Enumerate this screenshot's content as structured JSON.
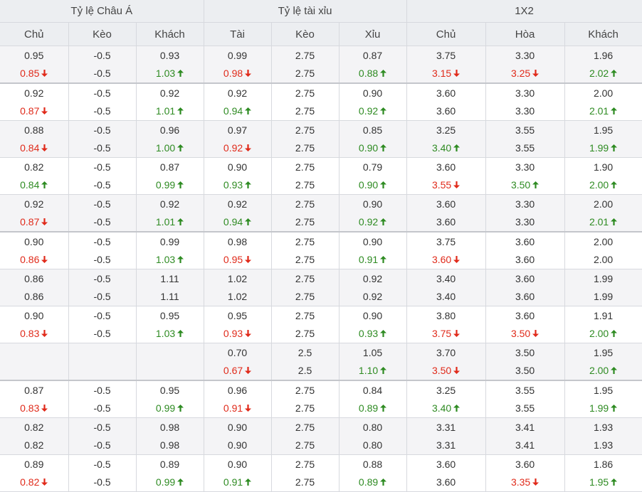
{
  "headers": {
    "groups": [
      "Tỷ lệ Châu Á",
      "Tỷ lệ tài xỉu",
      "1X2"
    ],
    "columns": [
      "Chủ",
      "Kèo",
      "Khách",
      "Tài",
      "Kèo",
      "Xỉu",
      "Chủ",
      "Hòa",
      "Khách"
    ]
  },
  "colors": {
    "up": "#2e8b22",
    "down": "#e02a1a",
    "header_bg": "#eceef1",
    "stripe_bg": "#f4f4f6"
  },
  "rows": [
    {
      "cells": [
        {
          "open": "0.95",
          "cur": "0.85",
          "trend": "down"
        },
        {
          "open": "-0.5",
          "cur": "-0.5",
          "trend": ""
        },
        {
          "open": "0.93",
          "cur": "1.03",
          "trend": "up"
        },
        {
          "open": "0.99",
          "cur": "0.98",
          "trend": "down"
        },
        {
          "open": "2.75",
          "cur": "2.75",
          "trend": ""
        },
        {
          "open": "0.87",
          "cur": "0.88",
          "trend": "up"
        },
        {
          "open": "3.75",
          "cur": "3.15",
          "trend": "down"
        },
        {
          "open": "3.30",
          "cur": "3.25",
          "trend": "down"
        },
        {
          "open": "1.96",
          "cur": "2.02",
          "trend": "up"
        }
      ]
    },
    {
      "cells": [
        {
          "open": "0.92",
          "cur": "0.87",
          "trend": "down"
        },
        {
          "open": "-0.5",
          "cur": "-0.5",
          "trend": ""
        },
        {
          "open": "0.92",
          "cur": "1.01",
          "trend": "up"
        },
        {
          "open": "0.92",
          "cur": "0.94",
          "trend": "up"
        },
        {
          "open": "2.75",
          "cur": "2.75",
          "trend": ""
        },
        {
          "open": "0.90",
          "cur": "0.92",
          "trend": "up"
        },
        {
          "open": "3.60",
          "cur": "3.60",
          "trend": ""
        },
        {
          "open": "3.30",
          "cur": "3.30",
          "trend": ""
        },
        {
          "open": "2.00",
          "cur": "2.01",
          "trend": "up"
        }
      ]
    },
    {
      "cells": [
        {
          "open": "0.88",
          "cur": "0.84",
          "trend": "down"
        },
        {
          "open": "-0.5",
          "cur": "-0.5",
          "trend": ""
        },
        {
          "open": "0.96",
          "cur": "1.00",
          "trend": "up"
        },
        {
          "open": "0.97",
          "cur": "0.92",
          "trend": "down"
        },
        {
          "open": "2.75",
          "cur": "2.75",
          "trend": ""
        },
        {
          "open": "0.85",
          "cur": "0.90",
          "trend": "up"
        },
        {
          "open": "3.25",
          "cur": "3.40",
          "trend": "up"
        },
        {
          "open": "3.55",
          "cur": "3.55",
          "trend": ""
        },
        {
          "open": "1.95",
          "cur": "1.99",
          "trend": "up"
        }
      ]
    },
    {
      "cells": [
        {
          "open": "0.82",
          "cur": "0.84",
          "trend": "up"
        },
        {
          "open": "-0.5",
          "cur": "-0.5",
          "trend": ""
        },
        {
          "open": "0.87",
          "cur": "0.99",
          "trend": "up"
        },
        {
          "open": "0.90",
          "cur": "0.93",
          "trend": "up"
        },
        {
          "open": "2.75",
          "cur": "2.75",
          "trend": ""
        },
        {
          "open": "0.79",
          "cur": "0.90",
          "trend": "up"
        },
        {
          "open": "3.60",
          "cur": "3.55",
          "trend": "down"
        },
        {
          "open": "3.30",
          "cur": "3.50",
          "trend": "up"
        },
        {
          "open": "1.90",
          "cur": "2.00",
          "trend": "up"
        }
      ]
    },
    {
      "cells": [
        {
          "open": "0.92",
          "cur": "0.87",
          "trend": "down"
        },
        {
          "open": "-0.5",
          "cur": "-0.5",
          "trend": ""
        },
        {
          "open": "0.92",
          "cur": "1.01",
          "trend": "up"
        },
        {
          "open": "0.92",
          "cur": "0.94",
          "trend": "up"
        },
        {
          "open": "2.75",
          "cur": "2.75",
          "trend": ""
        },
        {
          "open": "0.90",
          "cur": "0.92",
          "trend": "up"
        },
        {
          "open": "3.60",
          "cur": "3.60",
          "trend": ""
        },
        {
          "open": "3.30",
          "cur": "3.30",
          "trend": ""
        },
        {
          "open": "2.00",
          "cur": "2.01",
          "trend": "up"
        }
      ]
    },
    {
      "cells": [
        {
          "open": "0.90",
          "cur": "0.86",
          "trend": "down"
        },
        {
          "open": "-0.5",
          "cur": "-0.5",
          "trend": ""
        },
        {
          "open": "0.99",
          "cur": "1.03",
          "trend": "up"
        },
        {
          "open": "0.98",
          "cur": "0.95",
          "trend": "down"
        },
        {
          "open": "2.75",
          "cur": "2.75",
          "trend": ""
        },
        {
          "open": "0.90",
          "cur": "0.91",
          "trend": "up"
        },
        {
          "open": "3.75",
          "cur": "3.60",
          "trend": "down"
        },
        {
          "open": "3.60",
          "cur": "3.60",
          "trend": ""
        },
        {
          "open": "2.00",
          "cur": "2.00",
          "trend": ""
        }
      ]
    },
    {
      "cells": [
        {
          "open": "0.86",
          "cur": "0.86",
          "trend": ""
        },
        {
          "open": "-0.5",
          "cur": "-0.5",
          "trend": ""
        },
        {
          "open": "1.11",
          "cur": "1.11",
          "trend": ""
        },
        {
          "open": "1.02",
          "cur": "1.02",
          "trend": ""
        },
        {
          "open": "2.75",
          "cur": "2.75",
          "trend": ""
        },
        {
          "open": "0.92",
          "cur": "0.92",
          "trend": ""
        },
        {
          "open": "3.40",
          "cur": "3.40",
          "trend": ""
        },
        {
          "open": "3.60",
          "cur": "3.60",
          "trend": ""
        },
        {
          "open": "1.99",
          "cur": "1.99",
          "trend": ""
        }
      ]
    },
    {
      "cells": [
        {
          "open": "0.90",
          "cur": "0.83",
          "trend": "down"
        },
        {
          "open": "-0.5",
          "cur": "-0.5",
          "trend": ""
        },
        {
          "open": "0.95",
          "cur": "1.03",
          "trend": "up"
        },
        {
          "open": "0.95",
          "cur": "0.93",
          "trend": "down"
        },
        {
          "open": "2.75",
          "cur": "2.75",
          "trend": ""
        },
        {
          "open": "0.90",
          "cur": "0.93",
          "trend": "up"
        },
        {
          "open": "3.80",
          "cur": "3.75",
          "trend": "down"
        },
        {
          "open": "3.60",
          "cur": "3.50",
          "trend": "down"
        },
        {
          "open": "1.91",
          "cur": "2.00",
          "trend": "up"
        }
      ]
    },
    {
      "cells": [
        {
          "open": "",
          "cur": "",
          "trend": ""
        },
        {
          "open": "",
          "cur": "",
          "trend": ""
        },
        {
          "open": "",
          "cur": "",
          "trend": ""
        },
        {
          "open": "0.70",
          "cur": "0.67",
          "trend": "down"
        },
        {
          "open": "2.5",
          "cur": "2.5",
          "trend": ""
        },
        {
          "open": "1.05",
          "cur": "1.10",
          "trend": "up"
        },
        {
          "open": "3.70",
          "cur": "3.50",
          "trend": "down"
        },
        {
          "open": "3.50",
          "cur": "3.50",
          "trend": ""
        },
        {
          "open": "1.95",
          "cur": "2.00",
          "trend": "up"
        }
      ]
    },
    {
      "cells": [
        {
          "open": "0.87",
          "cur": "0.83",
          "trend": "down"
        },
        {
          "open": "-0.5",
          "cur": "-0.5",
          "trend": ""
        },
        {
          "open": "0.95",
          "cur": "0.99",
          "trend": "up"
        },
        {
          "open": "0.96",
          "cur": "0.91",
          "trend": "down"
        },
        {
          "open": "2.75",
          "cur": "2.75",
          "trend": ""
        },
        {
          "open": "0.84",
          "cur": "0.89",
          "trend": "up"
        },
        {
          "open": "3.25",
          "cur": "3.40",
          "trend": "up"
        },
        {
          "open": "3.55",
          "cur": "3.55",
          "trend": ""
        },
        {
          "open": "1.95",
          "cur": "1.99",
          "trend": "up"
        }
      ]
    },
    {
      "cells": [
        {
          "open": "0.82",
          "cur": "0.82",
          "trend": ""
        },
        {
          "open": "-0.5",
          "cur": "-0.5",
          "trend": ""
        },
        {
          "open": "0.98",
          "cur": "0.98",
          "trend": ""
        },
        {
          "open": "0.90",
          "cur": "0.90",
          "trend": ""
        },
        {
          "open": "2.75",
          "cur": "2.75",
          "trend": ""
        },
        {
          "open": "0.80",
          "cur": "0.80",
          "trend": ""
        },
        {
          "open": "3.31",
          "cur": "3.31",
          "trend": ""
        },
        {
          "open": "3.41",
          "cur": "3.41",
          "trend": ""
        },
        {
          "open": "1.93",
          "cur": "1.93",
          "trend": ""
        }
      ]
    },
    {
      "cells": [
        {
          "open": "0.89",
          "cur": "0.82",
          "trend": "down"
        },
        {
          "open": "-0.5",
          "cur": "-0.5",
          "trend": ""
        },
        {
          "open": "0.89",
          "cur": "0.99",
          "trend": "up"
        },
        {
          "open": "0.90",
          "cur": "0.91",
          "trend": "up"
        },
        {
          "open": "2.75",
          "cur": "2.75",
          "trend": ""
        },
        {
          "open": "0.88",
          "cur": "0.89",
          "trend": "up"
        },
        {
          "open": "3.60",
          "cur": "3.60",
          "trend": ""
        },
        {
          "open": "3.60",
          "cur": "3.35",
          "trend": "down"
        },
        {
          "open": "1.86",
          "cur": "1.95",
          "trend": "up"
        }
      ]
    }
  ]
}
